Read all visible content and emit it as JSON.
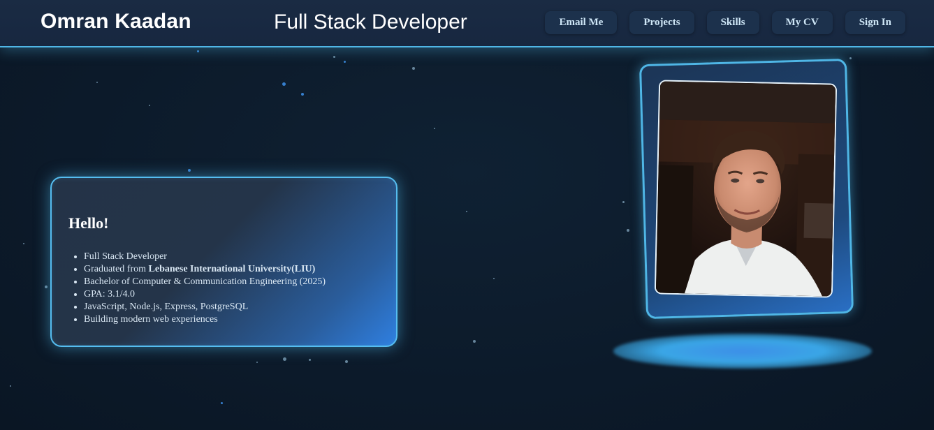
{
  "header": {
    "brand": "Omran Kaadan",
    "role": "Full Stack Developer",
    "nav": [
      {
        "label": "Email Me"
      },
      {
        "label": "Projects"
      },
      {
        "label": "Skills"
      },
      {
        "label": "My CV"
      },
      {
        "label": "Sign In"
      }
    ]
  },
  "intro": {
    "heading": "Hello!",
    "items": [
      {
        "text": "Full Stack Developer"
      },
      {
        "prefix": "Graduated from ",
        "strong": "Lebanese International University(LIU)"
      },
      {
        "text": "Bachelor of Computer & Communication Engineering (2025)"
      },
      {
        "text": "GPA: 3.1/4.0"
      },
      {
        "text": "JavaScript, Node.js, Express, PostgreSQL"
      },
      {
        "text": "Building modern web experiences"
      }
    ]
  },
  "portrait": {
    "icon": "profile-photo"
  },
  "colors": {
    "background": "#0c1a2a",
    "header": "#1a2b43",
    "accent": "#4fb6e6",
    "nav_button": "#1c314c",
    "nav_text": "#cfe7f7"
  }
}
